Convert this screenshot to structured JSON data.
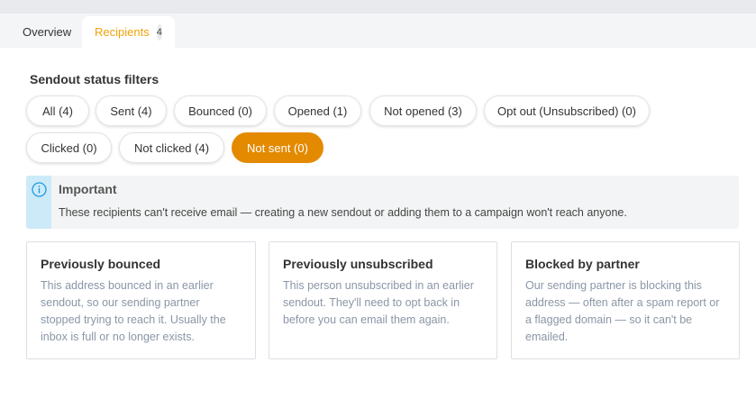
{
  "tabs": {
    "overview_label": "Overview",
    "recipients_label": "Recipients",
    "recipients_count": "4"
  },
  "filters": {
    "title": "Sendout status filters",
    "chips": [
      "All (4)",
      "Sent (4)",
      "Bounced (0)",
      "Opened (1)",
      "Not opened (3)",
      "Opt out (Unsubscribed) (0)",
      "Clicked (0)",
      "Not clicked (4)",
      "Not sent (0)"
    ],
    "active": "Not sent (0)",
    "active_color": "#e38a00"
  },
  "callout": {
    "icon": "info-icon",
    "title": "Important",
    "text": "These recipients can't receive email — creating a new sendout or adding them to a campaign won't reach anyone."
  },
  "cards": [
    {
      "title": "Previously bounced",
      "body": "This address bounced in an earlier sendout, so our sending partner stopped trying to reach it. Usually the inbox is full or no longer exists."
    },
    {
      "title": "Previously unsubscribed",
      "body": "This person unsubscribed in an earlier sendout. They'll need to opt back in before you can email them again."
    },
    {
      "title": "Blocked by partner",
      "body": "Our sending partner is blocking this address — often after a spam report or a flagged domain — so it can't be emailed."
    }
  ]
}
